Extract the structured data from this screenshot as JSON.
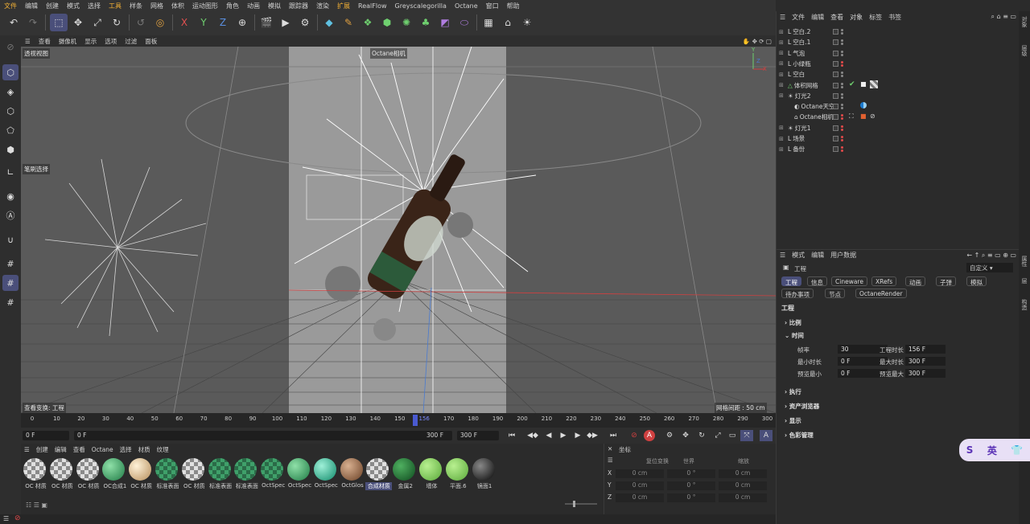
{
  "menubar": [
    "文件",
    "编辑",
    "创建",
    "模式",
    "选择",
    "工具",
    "样条",
    "网格",
    "体积",
    "运动图形",
    "角色",
    "动画",
    "模拟",
    "跟踪器",
    "渲染",
    "扩展",
    "RealFlow",
    "Greyscalegorilla",
    "Octane",
    "窗口",
    "帮助"
  ],
  "toolbar": {
    "undo": "↶",
    "redo": "↷",
    "x_axis": "X",
    "y_axis": "Y",
    "z_axis": "Z"
  },
  "viewport": {
    "menu": [
      "查看",
      "摄像机",
      "显示",
      "选项",
      "过滤",
      "面板"
    ],
    "name": "透视视图",
    "camera_label": "Octane相机",
    "selection_mode": "笔刷选择",
    "view_transform": "查看变换: 工程",
    "grid_spacing": "网格间距 : 50 cm",
    "axis_y": "Y",
    "axis_x": "X",
    "axis_z": "Z"
  },
  "timeline": {
    "ticks": [
      "0",
      "10",
      "20",
      "30",
      "40",
      "50",
      "60",
      "70",
      "80",
      "90",
      "100",
      "110",
      "120",
      "130",
      "140",
      "150",
      "156",
      "170",
      "180",
      "190",
      "200",
      "210",
      "220",
      "230",
      "240",
      "250",
      "260",
      "270",
      "280",
      "290",
      "300"
    ],
    "current_frame": "156",
    "start_field": "0 F",
    "current_field": "0 F",
    "end_field": "300 F",
    "max_field": "300 F"
  },
  "materials": {
    "menu": [
      "创建",
      "编辑",
      "查看",
      "Octane",
      "选择",
      "材质",
      "纹理"
    ],
    "items": [
      {
        "label": "OC 材质",
        "kind": "check"
      },
      {
        "label": "OC 材质",
        "kind": "check"
      },
      {
        "label": "OC 材质",
        "kind": "check"
      },
      {
        "label": "OC合成1",
        "kind": "green"
      },
      {
        "label": "OC 材质",
        "kind": "beige"
      },
      {
        "label": "标准表面",
        "kind": "greencheck"
      },
      {
        "label": "OC 材质",
        "kind": "check"
      },
      {
        "label": "标准表面",
        "kind": "greencheck"
      },
      {
        "label": "标准表面",
        "kind": "greencheck"
      },
      {
        "label": "OctSpec",
        "kind": "greencheck"
      },
      {
        "label": "OctSpec",
        "kind": "green"
      },
      {
        "label": "OctSpec",
        "kind": "teal"
      },
      {
        "label": "OctGlos",
        "kind": "brown"
      },
      {
        "label": "合成材质",
        "kind": "check"
      },
      {
        "label": "金属2",
        "kind": "darkgreen"
      },
      {
        "label": "墙体",
        "kind": "lime"
      },
      {
        "label": "平面.6",
        "kind": "lime"
      },
      {
        "label": "镜面1",
        "kind": "black"
      }
    ]
  },
  "coords": {
    "title": "坐标",
    "headers": [
      "复位变换",
      "世界",
      "缩放"
    ],
    "rows": [
      {
        "axis": "X",
        "pos": "0 cm",
        "rot": "0 °",
        "scale": "0 cm"
      },
      {
        "axis": "Y",
        "pos": "0 cm",
        "rot": "0 °",
        "scale": "0 cm"
      },
      {
        "axis": "Z",
        "pos": "0 cm",
        "rot": "0 °",
        "scale": "0 cm"
      }
    ]
  },
  "objects": {
    "menu": [
      "文件",
      "编辑",
      "查看",
      "对象",
      "标签",
      "书签"
    ],
    "items": [
      "空白.2",
      "空白.1",
      "气泡",
      "小绿瓶",
      "空白",
      "体积网格",
      "灯光2",
      "Octane天空",
      "Octane相机",
      "灯光1",
      "场景",
      "备份"
    ]
  },
  "attributes": {
    "menu": [
      "模式",
      "编辑",
      "用户数据"
    ],
    "title": "工程",
    "preset": "自定义",
    "tabs_row1": [
      "工程",
      "信息",
      "Cineware",
      "XRefs",
      "动画",
      "子弹",
      "模拟"
    ],
    "tabs_row2": [
      "待办事项",
      "节点",
      "OctaneRender"
    ],
    "section_title": "工程",
    "groups": [
      "比例",
      "时间",
      "执行",
      "资产浏览器",
      "显示",
      "色彩管理"
    ],
    "time": {
      "fps_label": "帧率",
      "fps": "30",
      "doc_len_label": "工程时长",
      "doc_len": "156 F",
      "min_label": "最小时长",
      "min": "0 F",
      "max_label": "最大时长",
      "max": "300 F",
      "pmin_label": "预览最小",
      "pmin": "0 F",
      "pmax_label": "预览最大",
      "pmax": "300 F"
    }
  },
  "side_tabs": [
    "对象",
    "层级",
    "属性",
    "层",
    "构造"
  ],
  "badge": {
    "s": "S",
    "text": "英"
  }
}
